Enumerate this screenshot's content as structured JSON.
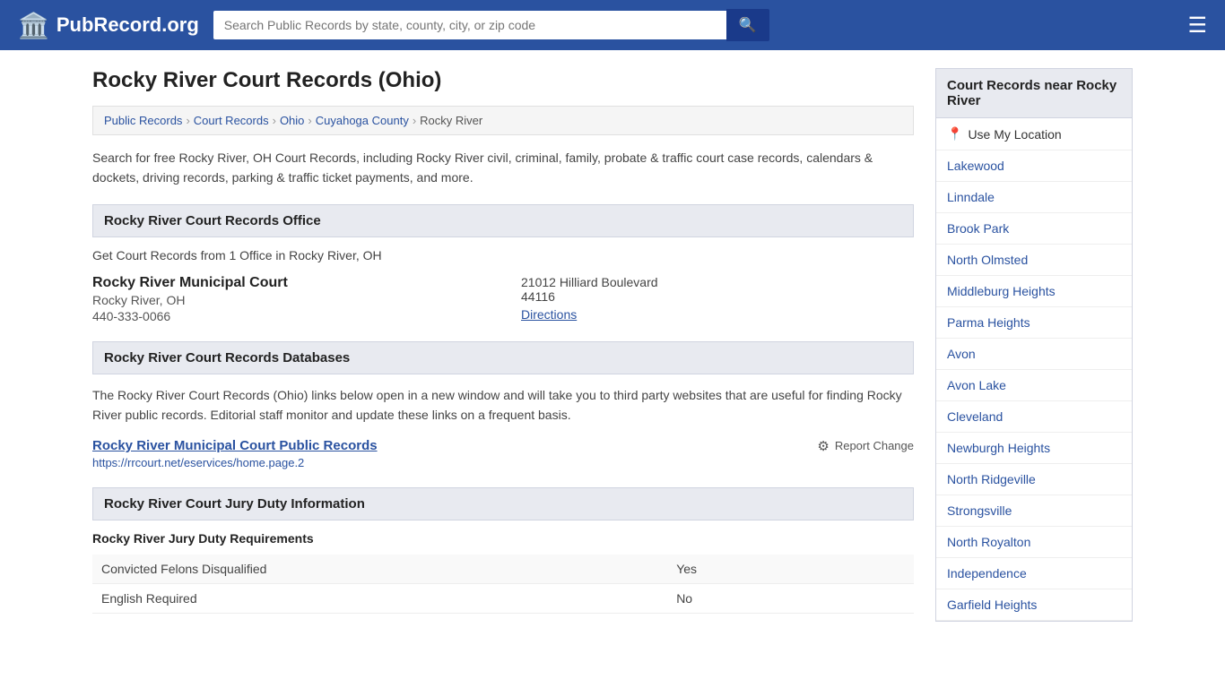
{
  "header": {
    "logo_text": "PubRecord.org",
    "search_placeholder": "Search Public Records by state, county, city, or zip code",
    "search_icon": "🔍",
    "menu_icon": "☰"
  },
  "page": {
    "title": "Rocky River Court Records (Ohio)",
    "description": "Search for free Rocky River, OH Court Records, including Rocky River civil, criminal, family, probate & traffic court case records, calendars & dockets, driving records, parking & traffic ticket payments, and more."
  },
  "breadcrumb": {
    "items": [
      {
        "label": "Public Records",
        "href": "#"
      },
      {
        "label": "Court Records",
        "href": "#"
      },
      {
        "label": "Ohio",
        "href": "#"
      },
      {
        "label": "Cuyahoga County",
        "href": "#"
      },
      {
        "label": "Rocky River",
        "href": "#"
      }
    ]
  },
  "office_section": {
    "header": "Rocky River Court Records Office",
    "sub_desc": "Get Court Records from 1 Office in Rocky River, OH",
    "court": {
      "name": "Rocky River Municipal Court",
      "city_state": "Rocky River, OH",
      "phone": "440-333-0066",
      "address": "21012 Hilliard Boulevard",
      "zip": "44116",
      "directions_label": "Directions"
    }
  },
  "databases_section": {
    "header": "Rocky River Court Records Databases",
    "description": "The Rocky River Court Records (Ohio) links below open in a new window and will take you to third party websites that are useful for finding Rocky River public records. Editorial staff monitor and update these links on a frequent basis.",
    "records": [
      {
        "name": "Rocky River Municipal Court Public Records",
        "url": "https://rrcourt.net/eservices/home.page.2",
        "report_change": "Report Change"
      }
    ]
  },
  "jury_section": {
    "header": "Rocky River Court Jury Duty Information",
    "sub_header": "Rocky River Jury Duty Requirements",
    "rows": [
      {
        "label": "Convicted Felons Disqualified",
        "value": "Yes"
      },
      {
        "label": "English Required",
        "value": "No"
      }
    ]
  },
  "sidebar": {
    "header": "Court Records near Rocky River",
    "use_location": "Use My Location",
    "items": [
      {
        "label": "Lakewood"
      },
      {
        "label": "Linndale"
      },
      {
        "label": "Brook Park"
      },
      {
        "label": "North Olmsted"
      },
      {
        "label": "Middleburg Heights"
      },
      {
        "label": "Parma Heights"
      },
      {
        "label": "Avon"
      },
      {
        "label": "Avon Lake"
      },
      {
        "label": "Cleveland"
      },
      {
        "label": "Newburgh Heights"
      },
      {
        "label": "North Ridgeville"
      },
      {
        "label": "Strongsville"
      },
      {
        "label": "North Royalton"
      },
      {
        "label": "Independence"
      },
      {
        "label": "Garfield Heights"
      }
    ]
  }
}
